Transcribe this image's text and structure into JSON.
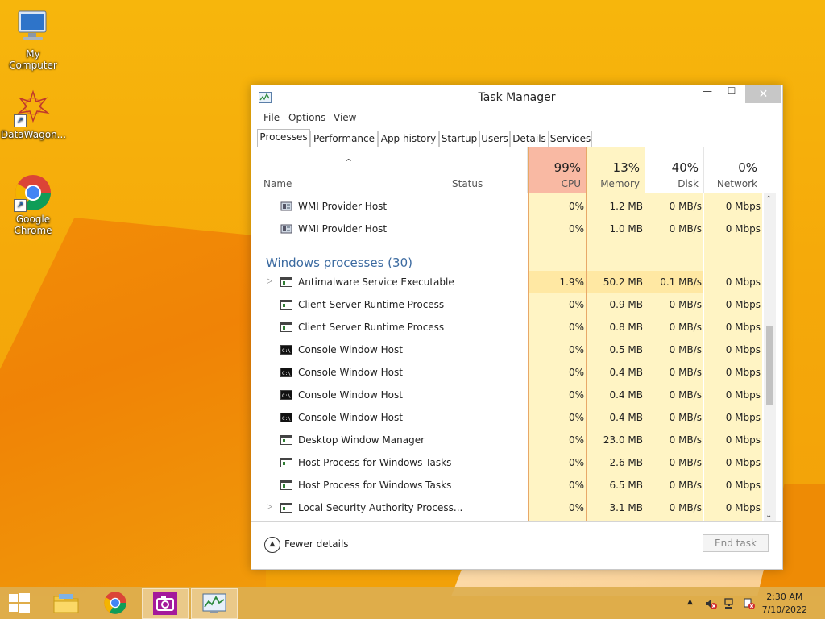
{
  "desktop": {
    "icons": [
      {
        "label": "My Computer"
      },
      {
        "label": "DataWagon..."
      },
      {
        "label": "Google Chrome"
      }
    ]
  },
  "window": {
    "title": "Task Manager",
    "close_glyph": "✕",
    "minimize_glyph": "—",
    "maximize_glyph": "☐",
    "menu": [
      "File",
      "Options",
      "View"
    ],
    "tabs": [
      "Processes",
      "Performance",
      "App history",
      "Startup",
      "Users",
      "Details",
      "Services"
    ],
    "active_tab": "Processes",
    "columns": {
      "name": "Name",
      "status": "Status",
      "sort_glyph": "^",
      "cpu": {
        "pct": "99%",
        "label": "CPU"
      },
      "memory": {
        "pct": "13%",
        "label": "Memory"
      },
      "disk": {
        "pct": "40%",
        "label": "Disk"
      },
      "network": {
        "pct": "0%",
        "label": "Network"
      }
    },
    "rows": [
      {
        "kind": "proc",
        "name": "WMI Provider Host",
        "icon": "service-icon",
        "cpu": "0%",
        "mem": "1.2 MB",
        "disk": "0 MB/s",
        "net": "0 Mbps"
      },
      {
        "kind": "proc",
        "name": "WMI Provider Host",
        "icon": "service-icon",
        "cpu": "0%",
        "mem": "1.0 MB",
        "disk": "0 MB/s",
        "net": "0 Mbps"
      },
      {
        "kind": "group",
        "name": "Windows processes (30)"
      },
      {
        "kind": "proc",
        "name": "Antimalware Service Executable",
        "icon": "app-window-icon",
        "expand": true,
        "cpu": "1.9%",
        "mem": "50.2 MB",
        "disk": "0.1 MB/s",
        "net": "0 Mbps"
      },
      {
        "kind": "proc",
        "name": "Client Server Runtime Process",
        "icon": "app-window-icon",
        "cpu": "0%",
        "mem": "0.9 MB",
        "disk": "0 MB/s",
        "net": "0 Mbps"
      },
      {
        "kind": "proc",
        "name": "Client Server Runtime Process",
        "icon": "app-window-icon",
        "cpu": "0%",
        "mem": "0.8 MB",
        "disk": "0 MB/s",
        "net": "0 Mbps"
      },
      {
        "kind": "proc",
        "name": "Console Window Host",
        "icon": "console-icon",
        "cpu": "0%",
        "mem": "0.5 MB",
        "disk": "0 MB/s",
        "net": "0 Mbps"
      },
      {
        "kind": "proc",
        "name": "Console Window Host",
        "icon": "console-icon",
        "cpu": "0%",
        "mem": "0.4 MB",
        "disk": "0 MB/s",
        "net": "0 Mbps"
      },
      {
        "kind": "proc",
        "name": "Console Window Host",
        "icon": "console-icon",
        "cpu": "0%",
        "mem": "0.4 MB",
        "disk": "0 MB/s",
        "net": "0 Mbps"
      },
      {
        "kind": "proc",
        "name": "Console Window Host",
        "icon": "console-icon",
        "cpu": "0%",
        "mem": "0.4 MB",
        "disk": "0 MB/s",
        "net": "0 Mbps"
      },
      {
        "kind": "proc",
        "name": "Desktop Window Manager",
        "icon": "app-window-icon",
        "cpu": "0%",
        "mem": "23.0 MB",
        "disk": "0 MB/s",
        "net": "0 Mbps"
      },
      {
        "kind": "proc",
        "name": "Host Process for Windows Tasks",
        "icon": "app-window-icon",
        "cpu": "0%",
        "mem": "2.6 MB",
        "disk": "0 MB/s",
        "net": "0 Mbps"
      },
      {
        "kind": "proc",
        "name": "Host Process for Windows Tasks",
        "icon": "app-window-icon",
        "cpu": "0%",
        "mem": "6.5 MB",
        "disk": "0 MB/s",
        "net": "0 Mbps"
      },
      {
        "kind": "proc",
        "name": "Local Security Authority Process...",
        "icon": "app-window-icon",
        "expand": true,
        "cpu": "0%",
        "mem": "3.1 MB",
        "disk": "0 MB/s",
        "net": "0 Mbps"
      }
    ],
    "footer": {
      "fewer_details": "Fewer details",
      "end_task": "End task"
    }
  },
  "taskbar": {
    "clock_time": "2:30 AM",
    "clock_date": "7/10/2022"
  },
  "colors": {
    "cpu_header": "#f9b9a3",
    "mem_header": "#fff4c4",
    "value_cell": "#fff4c4",
    "value_cell_hot": "#ffe8a3",
    "group_title": "#3b6aa0"
  }
}
